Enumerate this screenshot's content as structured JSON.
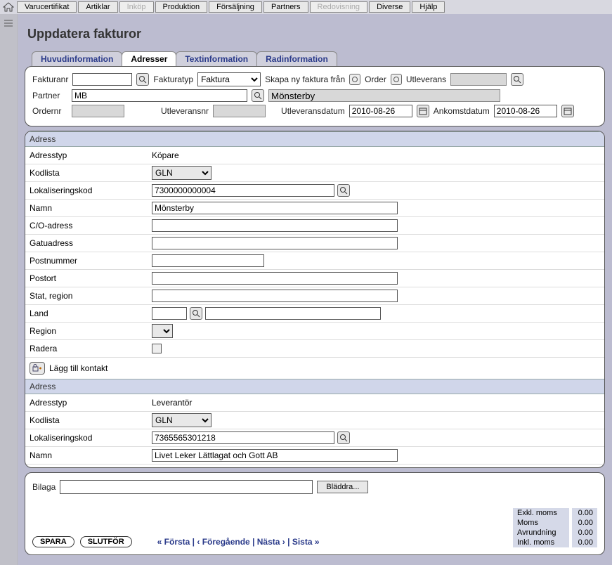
{
  "menu": {
    "items": [
      {
        "label": "Varucertifikat",
        "disabled": false
      },
      {
        "label": "Artiklar",
        "disabled": false
      },
      {
        "label": "Inköp",
        "disabled": true
      },
      {
        "label": "Produktion",
        "disabled": false
      },
      {
        "label": "Försäljning",
        "disabled": false
      },
      {
        "label": "Partners",
        "disabled": false
      },
      {
        "label": "Redovisning",
        "disabled": true
      },
      {
        "label": "Diverse",
        "disabled": false
      },
      {
        "label": "Hjälp",
        "disabled": false
      }
    ]
  },
  "page_title": "Uppdatera fakturor",
  "tabs": [
    {
      "label": "Huvudinformation",
      "active": false
    },
    {
      "label": "Adresser",
      "active": true
    },
    {
      "label": "Textinformation",
      "active": false
    },
    {
      "label": "Radinformation",
      "active": false
    }
  ],
  "header": {
    "fakturanr_label": "Fakturanr",
    "fakturanr_value": "",
    "fakturatyp_label": "Fakturatyp",
    "fakturatyp_value": "Faktura",
    "skapa_label": "Skapa ny faktura från",
    "order_label": "Order",
    "utleverans_label": "Utleverans",
    "utleverans_value": "",
    "partner_label": "Partner",
    "partner_code": "MB",
    "partner_name": "Mönsterby",
    "ordernr_label": "Ordernr",
    "ordernr_value": "",
    "utleveransnr_label": "Utleveransnr",
    "utleveransnr_value": "",
    "utleveransdatum_label": "Utleveransdatum",
    "utleveransdatum_value": "2010-08-26",
    "ankomstdatum_label": "Ankomstdatum",
    "ankomstdatum_value": "2010-08-26"
  },
  "sections": [
    {
      "title": "Adress",
      "fields": {
        "adresstyp_label": "Adresstyp",
        "adresstyp_value": "Köpare",
        "kodlista_label": "Kodlista",
        "kodlista_value": "GLN",
        "lokaliseringskod_label": "Lokaliseringskod",
        "lokaliseringskod_value": "7300000000004",
        "namn_label": "Namn",
        "namn_value": "Mönsterby",
        "co_label": "C/O-adress",
        "co_value": "",
        "gatu_label": "Gatuadress",
        "gatu_value": "",
        "postnr_label": "Postnummer",
        "postnr_value": "",
        "postort_label": "Postort",
        "postort_value": "",
        "stat_label": "Stat, region",
        "stat_value": "",
        "land_label": "Land",
        "land_code": "",
        "land_name": "",
        "region_label": "Region",
        "radera_label": "Radera"
      },
      "add_contact": "Lägg till kontakt"
    },
    {
      "title": "Adress",
      "fields": {
        "adresstyp_label": "Adresstyp",
        "adresstyp_value": "Leverantör",
        "kodlista_label": "Kodlista",
        "kodlista_value": "GLN",
        "lokaliseringskod_label": "Lokaliseringskod",
        "lokaliseringskod_value": "7365565301218",
        "namn_label": "Namn",
        "namn_value": "Livet Leker Lättlagat och Gott AB"
      }
    }
  ],
  "footer": {
    "bilaga_label": "Bilaga",
    "browse_label": "Bläddra...",
    "save_label": "SPARA",
    "finish_label": "SLUTFÖR",
    "nav_first": "« Första",
    "nav_prev": "‹ Föregående",
    "nav_next": "Nästa ›",
    "nav_last": "Sista »",
    "totals": [
      {
        "label": "Exkl. moms",
        "value": "0.00"
      },
      {
        "label": "Moms",
        "value": "0.00"
      },
      {
        "label": "Avrundning",
        "value": "0.00"
      },
      {
        "label": "Inkl. moms",
        "value": "0.00"
      }
    ]
  }
}
